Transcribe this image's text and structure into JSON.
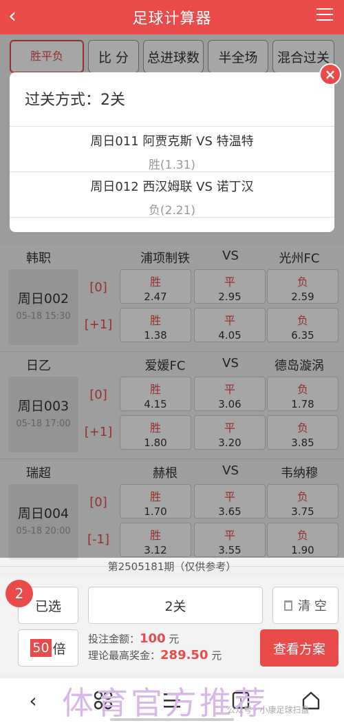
{
  "header": {
    "title": "足球计算器",
    "back": "‹",
    "menu_icon": "menu-icon"
  },
  "tabs": [
    {
      "label": "胜平负"
    },
    {
      "label": "比 分"
    },
    {
      "label": "总进球数"
    },
    {
      "label": "半全场"
    },
    {
      "label": "混合过关"
    }
  ],
  "matches": [
    {
      "league": "韩职",
      "home": "浦项制铁",
      "vs": "VS",
      "away": "光州FC",
      "code": "周日002",
      "time": "05-18 15:30",
      "rows": [
        {
          "handicap": "[0]",
          "odds": [
            {
              "l": "胜",
              "v": "2.47"
            },
            {
              "l": "平",
              "v": "2.95"
            },
            {
              "l": "负",
              "v": "2.59"
            }
          ]
        },
        {
          "handicap": "[+1]",
          "odds": [
            {
              "l": "胜",
              "v": "1.38"
            },
            {
              "l": "平",
              "v": "4.05"
            },
            {
              "l": "负",
              "v": "6.35"
            }
          ]
        }
      ]
    },
    {
      "league": "日乙",
      "home": "爱媛FC",
      "vs": "VS",
      "away": "德岛漩涡",
      "code": "周日003",
      "time": "05-18 17:00",
      "rows": [
        {
          "handicap": "[0]",
          "odds": [
            {
              "l": "胜",
              "v": "4.15"
            },
            {
              "l": "平",
              "v": "3.06"
            },
            {
              "l": "负",
              "v": "1.78"
            }
          ]
        },
        {
          "handicap": "[+1]",
          "odds": [
            {
              "l": "胜",
              "v": "1.80"
            },
            {
              "l": "平",
              "v": "3.20"
            },
            {
              "l": "负",
              "v": "3.85"
            }
          ]
        }
      ]
    },
    {
      "league": "瑞超",
      "home": "赫根",
      "vs": "VS",
      "away": "韦纳穆",
      "code": "周日004",
      "time": "05-18 20:00",
      "rows": [
        {
          "handicap": "[0]",
          "odds": [
            {
              "l": "胜",
              "v": "1.70"
            },
            {
              "l": "平",
              "v": "3.65"
            },
            {
              "l": "负",
              "v": "3.75"
            }
          ]
        },
        {
          "handicap": "[-1]",
          "odds": [
            {
              "l": "胜",
              "v": "3.12"
            },
            {
              "l": "平",
              "v": "3.55"
            },
            {
              "l": "负",
              "v": "1.90"
            }
          ]
        }
      ]
    }
  ],
  "issue": "第2505181期（仅供参考）",
  "bottom": {
    "badge": "2",
    "selected": "已选",
    "pass": "2关",
    "clear": "清 空",
    "multiple": "50",
    "multiple_unit": "倍",
    "bet_label": "投注金额：",
    "bet_amount": "100",
    "bet_unit": "元",
    "max_label": "理论最高奖金：",
    "max_amount": "289.50",
    "max_unit": "元",
    "view": "查看方案"
  },
  "dialog": {
    "title": "过关方式：2关",
    "items": [
      {
        "match": "周日011 阿贾克斯 VS 特温特",
        "pick": "胜(1.31)"
      },
      {
        "match": "周日012 西汉姆联 VS 诺丁汉",
        "pick": "负(2.21)"
      }
    ],
    "close": "×"
  },
  "nav": {
    "back": "‹",
    "tab_count": "1"
  },
  "watermark": "体育官方推荐",
  "wechat": "公众号 · 小康足球扫盘",
  "colors": {
    "accent": "#e94a4a"
  }
}
